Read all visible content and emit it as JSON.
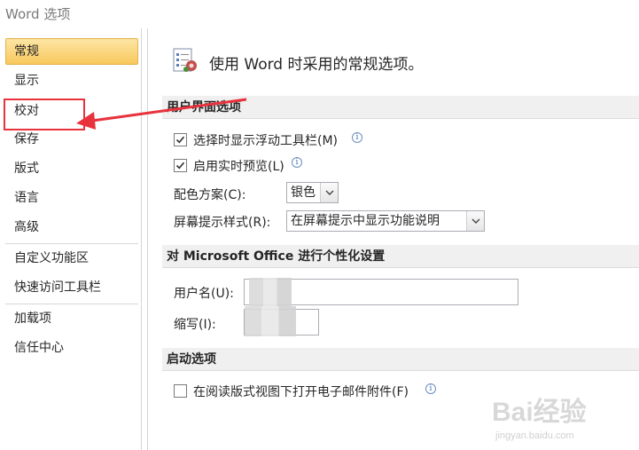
{
  "window": {
    "title": "Word 选项"
  },
  "sidebar": {
    "items": [
      {
        "label": "常规",
        "active": true
      },
      {
        "label": "显示"
      },
      {
        "label": "校对"
      },
      {
        "label": "保存"
      },
      {
        "label": "版式"
      },
      {
        "label": "语言"
      },
      {
        "label": "高级"
      },
      {
        "label": "自定义功能区"
      },
      {
        "label": "快速访问工具栏"
      },
      {
        "label": "加载项"
      },
      {
        "label": "信任中心"
      }
    ]
  },
  "main": {
    "heading": "使用 Word 时采用的常规选项。",
    "sections": {
      "ui": {
        "title": "用户界面选项",
        "opt_minitoolbar": "选择时显示浮动工具栏(M)",
        "opt_livepreview": "启用实时预览(L)",
        "color_scheme_label": "配色方案(C):",
        "color_scheme_value": "银色",
        "screentip_label": "屏幕提示样式(R):",
        "screentip_value": "在屏幕提示中显示功能说明"
      },
      "personalize": {
        "title": "对 Microsoft Office 进行个性化设置",
        "username_label": "用户名(U):",
        "initials_label": "缩写(I):"
      },
      "startup": {
        "title": "启动选项",
        "opt_reading_layout": "在阅读版式视图下打开电子邮件附件(F)"
      }
    }
  },
  "watermark": {
    "text": "Bai经验",
    "sub": "jingyan.baidu.com"
  },
  "colors": {
    "active_tab": "#f8c85d",
    "annotation": "#e8323c",
    "section_bg": "#f0f0f0"
  }
}
